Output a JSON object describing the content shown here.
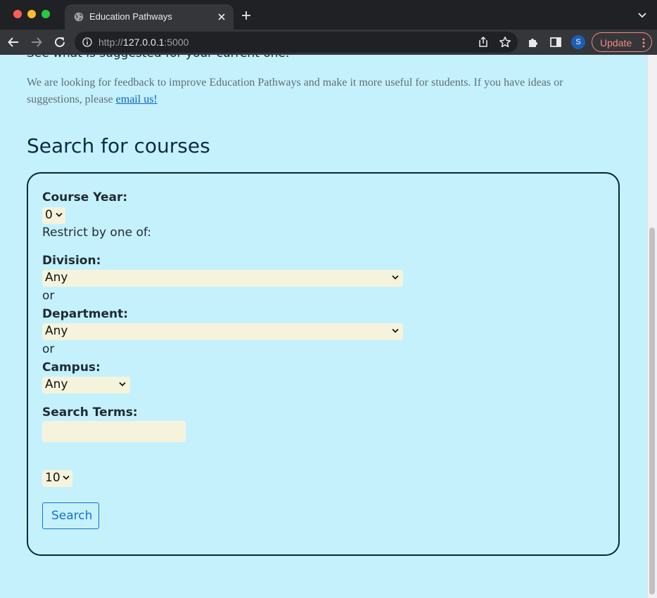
{
  "browser": {
    "tab_title": "Education Pathways",
    "url_scheme": "http://",
    "url_host": "127.0.0.1",
    "url_port": ":5000",
    "avatar_letter": "S",
    "update_label": "Update"
  },
  "page": {
    "cut_off_text": "See what is suggested for your current one.",
    "feedback_text": "We are looking for feedback to improve Education Pathways and make it more useful for students. If you have ideas or suggestions, please ",
    "feedback_link": "email us!",
    "section_title": "Search for courses"
  },
  "form": {
    "course_year_label": "Course Year:",
    "course_year_value": "0",
    "restrict_text": "Restrict by one of:",
    "division_label": "Division:",
    "division_value": "Any",
    "or_1": "or",
    "department_label": "Department:",
    "department_value": "Any",
    "or_2": "or",
    "campus_label": "Campus:",
    "campus_value": "Any",
    "search_terms_label": "Search Terms:",
    "search_terms_value": "",
    "results_count_value": "10",
    "search_button_label": "Search"
  },
  "colors": {
    "page_background": "#c5f1fd",
    "input_background": "#f6f3dd",
    "box_border": "#06263d",
    "link": "#0b63c4",
    "button_accent": "#1172d4"
  },
  "icons": [
    "globe-favicon-icon",
    "close-icon",
    "plus-icon",
    "chevron-down-icon",
    "back-arrow-icon",
    "forward-arrow-icon",
    "reload-icon",
    "info-icon",
    "share-icon",
    "star-icon",
    "puzzle-extensions-icon",
    "side-panel-icon",
    "kebab-menu-icon"
  ]
}
